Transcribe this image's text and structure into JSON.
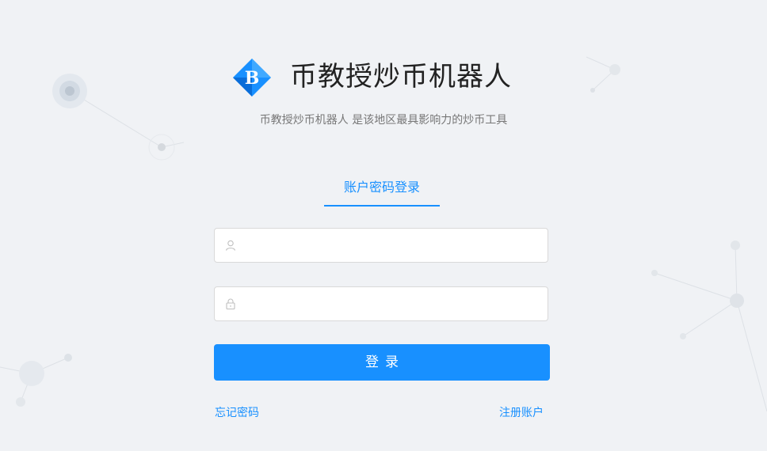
{
  "app": {
    "title": "币教授炒币机器人",
    "subtitle": "币教授炒币机器人 是该地区最具影响力的炒币工具",
    "logo_letter": "B",
    "logo_icon": "diamond-logo-icon"
  },
  "login": {
    "tab_label": "账户密码登录",
    "username": {
      "value": "",
      "placeholder": "",
      "icon": "user-icon"
    },
    "password": {
      "value": "",
      "placeholder": "",
      "icon": "lock-icon"
    },
    "submit_label": "登录",
    "forgot_label": "忘记密码",
    "register_label": "注册账户"
  },
  "colors": {
    "primary": "#1890ff",
    "background": "#f0f2f5",
    "title_text": "#222222",
    "subtitle_text": "#777777"
  }
}
